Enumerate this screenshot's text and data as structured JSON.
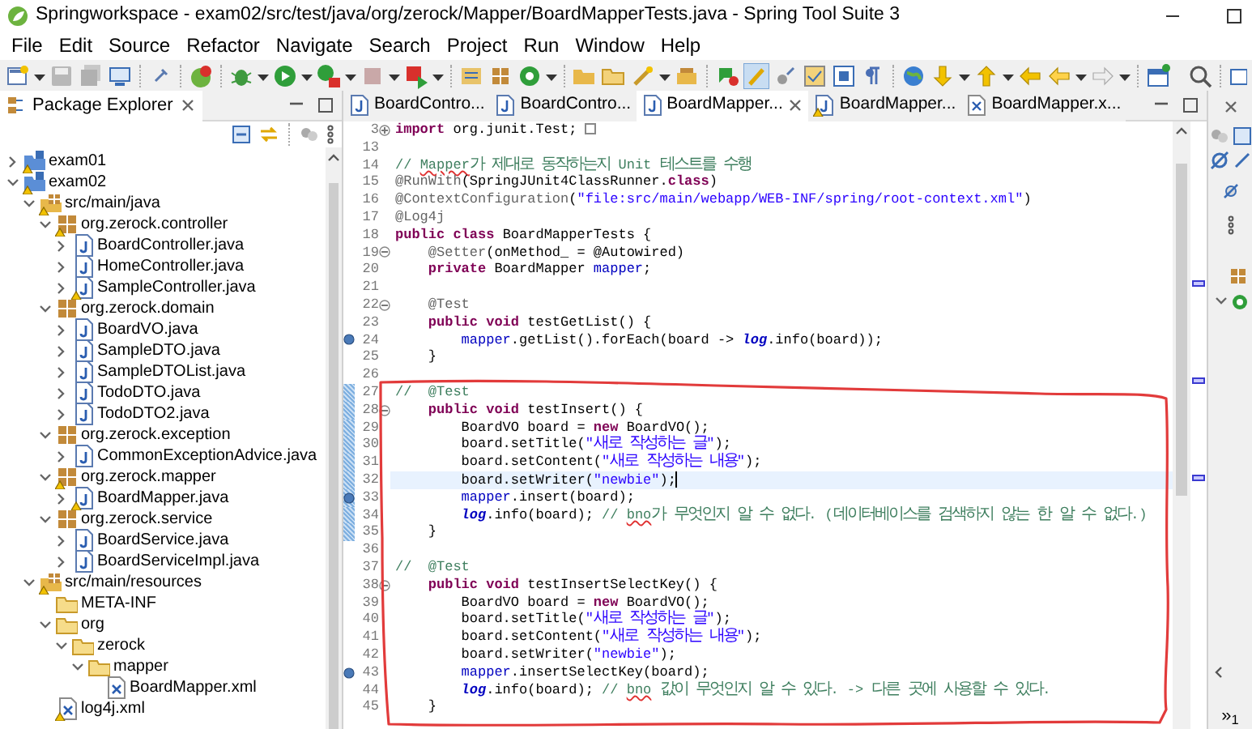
{
  "window": {
    "title": "Springworkspace - exam02/src/test/java/org/zerock/Mapper/BoardMapperTests.java - Spring Tool Suite 3"
  },
  "menu": [
    "File",
    "Edit",
    "Source",
    "Refactor",
    "Navigate",
    "Search",
    "Project",
    "Run",
    "Window",
    "Help"
  ],
  "package_explorer": {
    "tab": "Package Explorer",
    "tree": [
      {
        "label": "exam01",
        "kind": "project",
        "expanded": false,
        "warning": true
      },
      {
        "label": "exam02",
        "kind": "project",
        "expanded": true,
        "warning": true,
        "children": [
          {
            "label": "src/main/java",
            "kind": "source-folder",
            "expanded": true,
            "warning": true,
            "children": [
              {
                "label": "org.zerock.controller",
                "kind": "package",
                "expanded": true,
                "warning": true,
                "children": [
                  {
                    "label": "BoardController.java",
                    "kind": "java",
                    "expanded": false,
                    "warning": false
                  },
                  {
                    "label": "HomeController.java",
                    "kind": "java",
                    "expanded": false,
                    "warning": false
                  },
                  {
                    "label": "SampleController.java",
                    "kind": "java",
                    "expanded": false,
                    "warning": true
                  }
                ]
              },
              {
                "label": "org.zerock.domain",
                "kind": "package",
                "expanded": true,
                "warning": false,
                "children": [
                  {
                    "label": "BoardVO.java",
                    "kind": "java",
                    "expanded": false,
                    "warning": false
                  },
                  {
                    "label": "SampleDTO.java",
                    "kind": "java",
                    "expanded": false,
                    "warning": false
                  },
                  {
                    "label": "SampleDTOList.java",
                    "kind": "java",
                    "expanded": false,
                    "warning": false
                  },
                  {
                    "label": "TodoDTO.java",
                    "kind": "java",
                    "expanded": false,
                    "warning": false
                  },
                  {
                    "label": "TodoDTO2.java",
                    "kind": "java",
                    "expanded": false,
                    "warning": false
                  }
                ]
              },
              {
                "label": "org.zerock.exception",
                "kind": "package",
                "expanded": true,
                "warning": false,
                "children": [
                  {
                    "label": "CommonExceptionAdvice.java",
                    "kind": "java",
                    "expanded": false,
                    "warning": false
                  }
                ]
              },
              {
                "label": "org.zerock.mapper",
                "kind": "package",
                "expanded": true,
                "warning": true,
                "children": [
                  {
                    "label": "BoardMapper.java",
                    "kind": "java",
                    "expanded": false,
                    "warning": true
                  }
                ]
              },
              {
                "label": "org.zerock.service",
                "kind": "package",
                "expanded": true,
                "warning": false,
                "children": [
                  {
                    "label": "BoardService.java",
                    "kind": "java",
                    "expanded": false,
                    "warning": false
                  },
                  {
                    "label": "BoardServiceImpl.java",
                    "kind": "java",
                    "expanded": false,
                    "warning": false
                  }
                ]
              }
            ]
          },
          {
            "label": "src/main/resources",
            "kind": "source-folder",
            "expanded": true,
            "warning": true,
            "children": [
              {
                "label": "META-INF",
                "kind": "folder",
                "warning": false
              },
              {
                "label": "org",
                "kind": "folder",
                "expanded": true,
                "warning": false,
                "children": [
                  {
                    "label": "zerock",
                    "kind": "folder",
                    "expanded": true,
                    "warning": false,
                    "children": [
                      {
                        "label": "mapper",
                        "kind": "folder",
                        "expanded": true,
                        "warning": false,
                        "children": [
                          {
                            "label": "BoardMapper.xml",
                            "kind": "xml",
                            "warning": false
                          }
                        ]
                      }
                    ]
                  }
                ]
              },
              {
                "label": "log4j.xml",
                "kind": "xml",
                "warning": true
              }
            ]
          }
        ]
      }
    ]
  },
  "editor": {
    "tabs": [
      {
        "label": "BoardContro...",
        "kind": "java",
        "selected": false,
        "warning": false
      },
      {
        "label": "BoardContro...",
        "kind": "java",
        "selected": false,
        "warning": false
      },
      {
        "label": "BoardMapper...",
        "kind": "java",
        "selected": true,
        "warning": false
      },
      {
        "label": "BoardMapper...",
        "kind": "java",
        "selected": false,
        "warning": true
      },
      {
        "label": "BoardMapper.x...",
        "kind": "xml",
        "selected": false,
        "warning": false
      }
    ],
    "lines": [
      {
        "number": "3",
        "fold_open": false,
        "marked": false,
        "changed": false,
        "current": false,
        "tokens": [
          {
            "kind": "keyword",
            "text": "import"
          },
          {
            "kind": "plain",
            "text": " org.junit.Test;"
          }
        ]
      },
      {
        "number": "13",
        "marked": false,
        "changed": false,
        "current": false
      },
      {
        "number": "14",
        "marked": false,
        "changed": false,
        "current": false,
        "tokens": [
          {
            "kind": "comment",
            "text": "// "
          },
          {
            "kind": "typo",
            "text": "Mapper"
          },
          {
            "kind": "comment",
            "text": "가 제대로 동작하는지 Unit 테스트를 수행"
          }
        ]
      },
      {
        "number": "15",
        "marked": false,
        "changed": false,
        "current": false,
        "tokens": [
          {
            "kind": "annotation",
            "text": "@RunWith"
          },
          {
            "kind": "plain",
            "text": "(SpringJUnit4ClassRunner."
          },
          {
            "kind": "keyword",
            "text": "class"
          },
          {
            "kind": "plain",
            "text": ")"
          }
        ]
      },
      {
        "number": "16",
        "marked": false,
        "changed": false,
        "current": false,
        "tokens": [
          {
            "kind": "annotation",
            "text": "@ContextConfiguration"
          },
          {
            "kind": "plain",
            "text": "("
          },
          {
            "kind": "string",
            "text": "\"file:src/main/webapp/WEB-INF/spring/root-context.xml\""
          },
          {
            "kind": "plain",
            "text": ")"
          }
        ]
      },
      {
        "number": "17",
        "marked": false,
        "changed": false,
        "current": false,
        "tokens": [
          {
            "kind": "annotation",
            "text": "@Log4j"
          }
        ]
      },
      {
        "number": "18",
        "marked": false,
        "changed": false,
        "current": false,
        "tokens": [
          {
            "kind": "keyword",
            "text": "public class"
          },
          {
            "kind": "plain",
            "text": " BoardMapperTests {"
          }
        ]
      },
      {
        "number": "19",
        "fold_open": true,
        "marked": false,
        "changed": false,
        "current": false,
        "tokens": [
          {
            "kind": "annotation",
            "text": "    @Setter"
          },
          {
            "kind": "plain",
            "text": "(onMethod_ = @Autowired)"
          }
        ]
      },
      {
        "number": "20",
        "marked": false,
        "changed": false,
        "current": false,
        "tokens": [
          {
            "kind": "keyword",
            "text": "    private"
          },
          {
            "kind": "plain",
            "text": " BoardMapper "
          },
          {
            "kind": "field",
            "text": "mapper"
          },
          {
            "kind": "plain",
            "text": ";"
          }
        ]
      },
      {
        "number": "21",
        "marked": false,
        "changed": false,
        "current": false
      },
      {
        "number": "22",
        "fold_open": true,
        "marked": false,
        "changed": false,
        "current": false,
        "tokens": [
          {
            "kind": "annotation",
            "text": "    @Test"
          }
        ]
      },
      {
        "number": "23",
        "marked": false,
        "changed": false,
        "current": false,
        "tokens": [
          {
            "kind": "keyword",
            "text": "    public void"
          },
          {
            "kind": "plain",
            "text": " testGetList() {"
          }
        ]
      },
      {
        "number": "24",
        "marked": true,
        "changed": false,
        "current": false,
        "tokens": [
          {
            "kind": "field",
            "text": "        mapper"
          },
          {
            "kind": "plain",
            "text": ".getList().forEach(board -> "
          },
          {
            "kind": "static",
            "text": "log"
          },
          {
            "kind": "plain",
            "text": ".info(board));"
          }
        ]
      },
      {
        "number": "25",
        "marked": false,
        "changed": false,
        "current": false,
        "tokens": [
          {
            "kind": "plain",
            "text": "    }"
          }
        ]
      },
      {
        "number": "26",
        "marked": false,
        "changed": false,
        "current": false
      },
      {
        "number": "27",
        "marked": false,
        "changed": true,
        "current": false,
        "tokens": [
          {
            "kind": "comment",
            "text": "//  @Test"
          }
        ]
      },
      {
        "number": "28",
        "fold_open": true,
        "marked": false,
        "changed": true,
        "current": false,
        "tokens": [
          {
            "kind": "keyword",
            "text": "    public void"
          },
          {
            "kind": "plain",
            "text": " testInsert() {"
          }
        ]
      },
      {
        "number": "29",
        "marked": false,
        "changed": true,
        "current": false,
        "tokens": [
          {
            "kind": "plain",
            "text": "        BoardVO board = "
          },
          {
            "kind": "keyword",
            "text": "new"
          },
          {
            "kind": "plain",
            "text": " BoardVO();"
          }
        ]
      },
      {
        "number": "30",
        "marked": false,
        "changed": true,
        "current": false,
        "tokens": [
          {
            "kind": "plain",
            "text": "        board.setTitle("
          },
          {
            "kind": "string",
            "text": "\"새로 작성하는 글\""
          },
          {
            "kind": "plain",
            "text": ");"
          }
        ]
      },
      {
        "number": "31",
        "marked": false,
        "changed": true,
        "current": false,
        "tokens": [
          {
            "kind": "plain",
            "text": "        board.setContent("
          },
          {
            "kind": "string",
            "text": "\"새로 작성하는 내용\""
          },
          {
            "kind": "plain",
            "text": ");"
          }
        ]
      },
      {
        "number": "32",
        "marked": false,
        "changed": true,
        "current": true,
        "tokens": [
          {
            "kind": "plain",
            "text": "        board.setWriter("
          },
          {
            "kind": "string",
            "text": "\"newbie\""
          },
          {
            "kind": "plain",
            "text": ");"
          }
        ]
      },
      {
        "number": "33",
        "marked": true,
        "changed": true,
        "current": false,
        "tokens": [
          {
            "kind": "field",
            "text": "        mapper"
          },
          {
            "kind": "plain",
            "text": ".insert(board);"
          }
        ]
      },
      {
        "number": "34",
        "marked": false,
        "changed": true,
        "current": false,
        "tokens": [
          {
            "kind": "static",
            "text": "        log"
          },
          {
            "kind": "plain",
            "text": ".info(board); "
          },
          {
            "kind": "comment",
            "text": "// "
          },
          {
            "kind": "typo",
            "text": "bno"
          },
          {
            "kind": "comment",
            "text": "가 무엇인지 알 수 없다. (데이터베이스를 검색하지 않는 한 알 수 없다.)"
          }
        ]
      },
      {
        "number": "35",
        "marked": false,
        "changed": true,
        "current": false,
        "tokens": [
          {
            "kind": "plain",
            "text": "    }"
          }
        ]
      },
      {
        "number": "36",
        "marked": false,
        "changed": false,
        "current": false
      },
      {
        "number": "37",
        "marked": false,
        "changed": false,
        "current": false,
        "tokens": [
          {
            "kind": "comment",
            "text": "//  @Test"
          }
        ]
      },
      {
        "number": "38",
        "fold_open": true,
        "marked": false,
        "changed": false,
        "current": false,
        "tokens": [
          {
            "kind": "keyword",
            "text": "    public void"
          },
          {
            "kind": "plain",
            "text": " testInsertSelectKey() {"
          }
        ]
      },
      {
        "number": "39",
        "marked": false,
        "changed": false,
        "current": false,
        "tokens": [
          {
            "kind": "plain",
            "text": "        BoardVO board = "
          },
          {
            "kind": "keyword",
            "text": "new"
          },
          {
            "kind": "plain",
            "text": " BoardVO();"
          }
        ]
      },
      {
        "number": "40",
        "marked": false,
        "changed": false,
        "current": false,
        "tokens": [
          {
            "kind": "plain",
            "text": "        board.setTitle("
          },
          {
            "kind": "string",
            "text": "\"새로 작성하는 글\""
          },
          {
            "kind": "plain",
            "text": ");"
          }
        ]
      },
      {
        "number": "41",
        "marked": false,
        "changed": false,
        "current": false,
        "tokens": [
          {
            "kind": "plain",
            "text": "        board.setContent("
          },
          {
            "kind": "string",
            "text": "\"새로 작성하는 내용\""
          },
          {
            "kind": "plain",
            "text": ");"
          }
        ]
      },
      {
        "number": "42",
        "marked": false,
        "changed": false,
        "current": false,
        "tokens": [
          {
            "kind": "plain",
            "text": "        board.setWriter("
          },
          {
            "kind": "string",
            "text": "\"newbie\""
          },
          {
            "kind": "plain",
            "text": ");"
          }
        ]
      },
      {
        "number": "43",
        "marked": true,
        "changed": false,
        "current": false,
        "tokens": [
          {
            "kind": "field",
            "text": "        mapper"
          },
          {
            "kind": "plain",
            "text": ".insertSelectKey(board);"
          }
        ]
      },
      {
        "number": "44",
        "marked": false,
        "changed": false,
        "current": false,
        "tokens": [
          {
            "kind": "static",
            "text": "        log"
          },
          {
            "kind": "plain",
            "text": ".info(board); "
          },
          {
            "kind": "comment",
            "text": "// "
          },
          {
            "kind": "typo",
            "text": "bno"
          },
          {
            "kind": "comment",
            "text": " 값이 무엇인지 알 수 있다. -> 다른 곳에 사용할 수 있다."
          }
        ]
      },
      {
        "number": "45",
        "marked": false,
        "changed": false,
        "current": false,
        "tokens": [
          {
            "kind": "plain",
            "text": "    }"
          }
        ]
      }
    ]
  },
  "right_panel": {
    "overflow": "»",
    "overflow_count": "1"
  }
}
